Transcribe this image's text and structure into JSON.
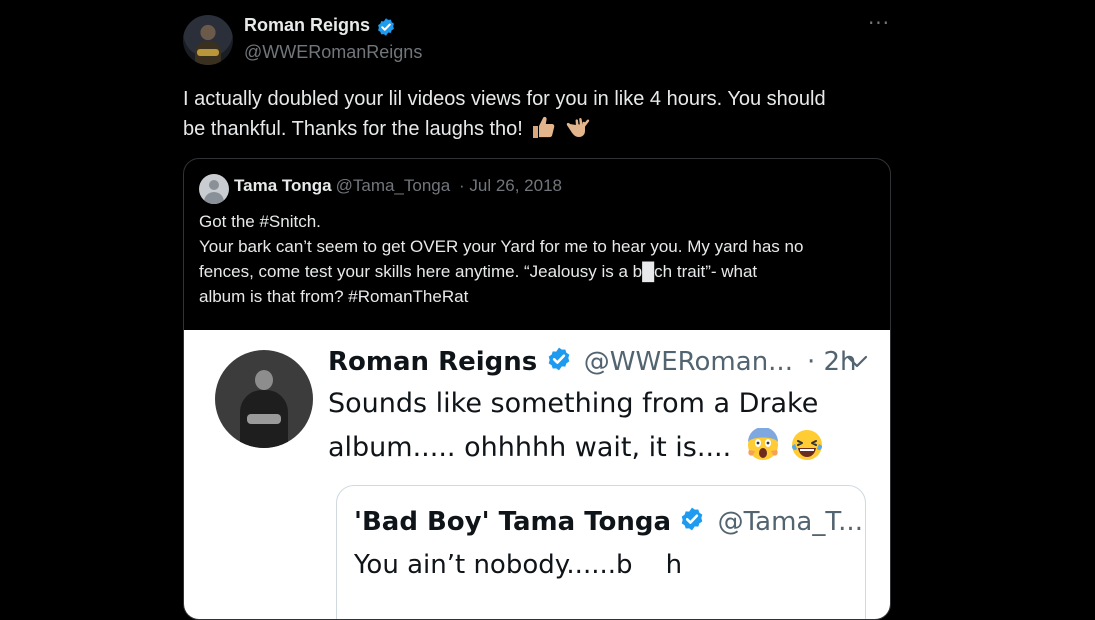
{
  "tweet": {
    "author_name": "Roman Reigns",
    "author_handle": "@WWERomanReigns",
    "more_label": "···",
    "text_lines": [
      "I actually doubled your lil videos views for you in like 4 hours.  You should",
      "be thankful. Thanks for the laughs tho!"
    ]
  },
  "quote": {
    "author_name": "Tama Tonga",
    "author_handle": "@Tama_Tonga",
    "separator": "·",
    "date": "Jul 26, 2018",
    "text_lines": [
      "Got the #Snitch.",
      "Your bark can’t seem to get OVER your Yard for me to hear you. My yard has no",
      "fences, come test your skills here anytime. “Jealousy is a b█ch trait”- what",
      "album is that from? #RomanTheRat"
    ]
  },
  "embedded": {
    "author_name": "Roman Reigns",
    "author_handle": "@WWERoman...",
    "time": "· 2h",
    "text_lines": [
      "Sounds like something from a Drake",
      "album..... ohhhhh wait, it is...."
    ],
    "nested": {
      "author_name": "'Bad Boy' Tama Tonga",
      "author_handle": "@Tama_T...",
      "text": "You ain’t nobody......b    h"
    }
  },
  "colors": {
    "background": "#000000",
    "text_primary": "#e7e9ea",
    "text_secondary": "#71767b",
    "verified": "#1d9bf0",
    "border": "#2f3336"
  },
  "icons": [
    "verified-badge-icon",
    "more-options-icon",
    "thumbs-up-emoji-icon",
    "call-me-hand-emoji-icon",
    "screaming-face-emoji-icon",
    "laughing-tears-emoji-icon",
    "chevron-down-icon"
  ]
}
